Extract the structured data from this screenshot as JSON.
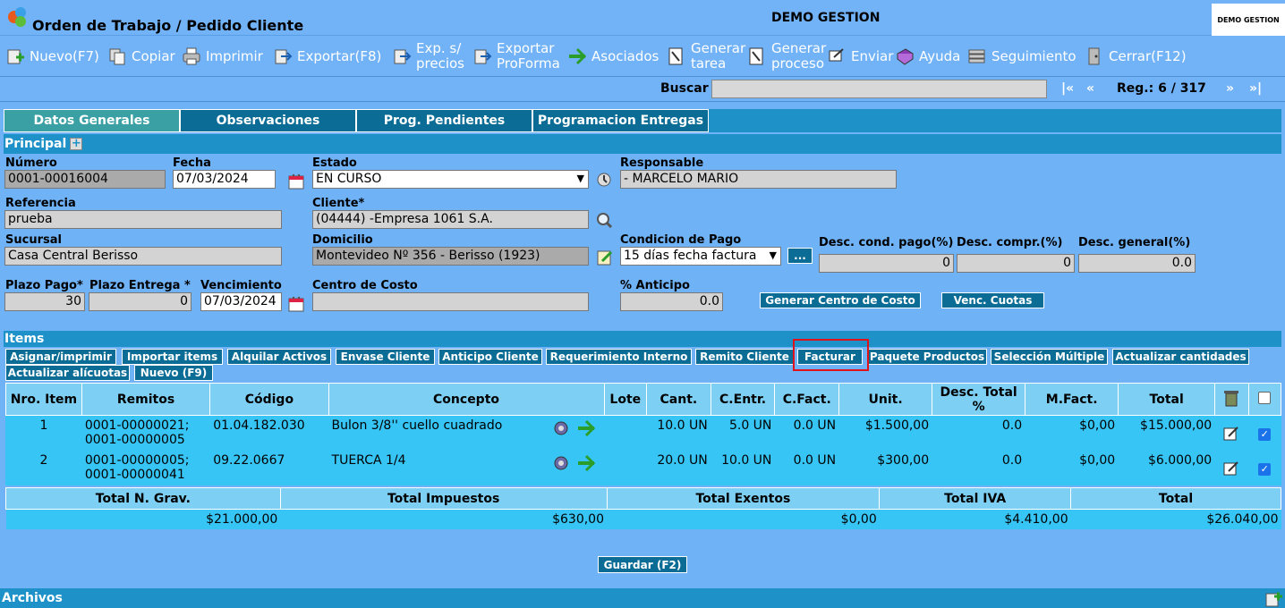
{
  "window": {
    "title": "Orden de Trabajo / Pedido Cliente",
    "app_name": "DEMO GESTION",
    "brand_box": "DEMO GESTION"
  },
  "toolbar": {
    "nuevo": "Nuevo(F7)",
    "copiar": "Copiar",
    "imprimir": "Imprimir",
    "exportar": "Exportar(F8)",
    "exp_precios_1": "Exp. s/",
    "exp_precios_2": "precios",
    "exportar_proforma_1": "Exportar",
    "exportar_proforma_2": "ProForma",
    "asociados": "Asociados",
    "generar_tarea_1": "Generar",
    "generar_tarea_2": "tarea",
    "generar_proceso_1": "Generar",
    "generar_proceso_2": "proceso",
    "enviar": "Enviar",
    "ayuda": "Ayuda",
    "seguimiento": "Seguimiento",
    "cerrar": "Cerrar(F12)"
  },
  "search": {
    "label": "Buscar",
    "value": "",
    "first": "|«",
    "prev": "«",
    "record": "Reg.: 6 / 317",
    "next": "»",
    "last": "»|"
  },
  "tabs": [
    "Datos Generales",
    "Observaciones",
    "Prog. Pendientes",
    "Programacion Entregas"
  ],
  "principal": {
    "title": "Principal",
    "expand": "+"
  },
  "form": {
    "numero_label": "Número",
    "numero": "0001-00016004",
    "fecha_label": "Fecha",
    "fecha": "07/03/2024",
    "estado_label": "Estado",
    "estado": "EN CURSO",
    "responsable_label": "Responsable",
    "responsable": "- MARCELO MARIO",
    "referencia_label": "Referencia",
    "referencia": "prueba",
    "cliente_label": "Cliente*",
    "cliente": "(04444) -Empresa 1061 S.A.",
    "sucursal_label": "Sucursal",
    "sucursal": "Casa Central Berisso",
    "domicilio_label": "Domicilio",
    "domicilio": "Montevideo Nº 356 - Berisso (1923)",
    "condicion_label": "Condicion de Pago",
    "condicion": "15 días fecha factura",
    "condicion_btn": "...",
    "desc_cond_label": "Desc. cond. pago(%)",
    "desc_cond": "0",
    "desc_compr_label": "Desc. compr.(%)",
    "desc_compr": "0",
    "desc_general_label": "Desc. general(%)",
    "desc_general": "0.0",
    "plazo_pago_label": "Plazo Pago*",
    "plazo_pago": "30",
    "plazo_entrega_label": "Plazo Entrega *",
    "plazo_entrega": "0",
    "vencimiento_label": "Vencimiento",
    "vencimiento": "07/03/2024",
    "centro_costo_label": "Centro de Costo",
    "centro_costo": "",
    "anticipo_label": "% Anticipo",
    "anticipo": "0.0",
    "generar_cc": "Generar Centro de Costo",
    "venc_cuotas": "Venc. Cuotas"
  },
  "items": {
    "title": "Items",
    "buttons": [
      "Asignar/imprimir",
      "Importar items",
      "Alquilar Activos",
      "Envase Cliente",
      "Anticipo Cliente",
      "Requerimiento Interno",
      "Remito Cliente",
      "Facturar",
      "Paquete Productos",
      "Selección Múltiple",
      "Actualizar cantidades",
      "Actualizar alícuotas",
      "Nuevo (F9)"
    ],
    "columns": [
      "Nro. Item",
      "Remitos",
      "Código",
      "Concepto",
      "Lote",
      "Cant.",
      "C.Entr.",
      "C.Fact.",
      "Unit.",
      "Desc. Total %",
      "M.Fact.",
      "Total"
    ],
    "rows": [
      {
        "nro": "1",
        "remito1": "0001-00000021;",
        "remito2": "0001-00000005",
        "codigo": "01.04.182.030",
        "concepto": "Bulon 3/8'' cuello cuadrado",
        "lote": "",
        "cant": "10.0 UN",
        "centr": "5.0 UN",
        "cfact": "0.0 UN",
        "unit": "$1.500,00",
        "desc": "0.0",
        "mfact": "$0,00",
        "total": "$15.000,00"
      },
      {
        "nro": "2",
        "remito1": "0001-00000005;",
        "remito2": "0001-00000041",
        "codigo": "09.22.0667",
        "concepto": "TUERCA 1/4",
        "lote": "",
        "cant": "20.0 UN",
        "centr": "10.0 UN",
        "cfact": "0.0 UN",
        "unit": "$300,00",
        "desc": "0.0",
        "mfact": "$0,00",
        "total": "$6.000,00"
      }
    ]
  },
  "totals": {
    "headers": [
      "Total N. Grav.",
      "Total Impuestos",
      "Total Exentos",
      "Total IVA",
      "Total"
    ],
    "values": [
      "$21.000,00",
      "$630,00",
      "$0,00",
      "$4.410,00",
      "$26.040,00"
    ]
  },
  "guardar": "Guardar (F2)",
  "archivos": "Archivos"
}
